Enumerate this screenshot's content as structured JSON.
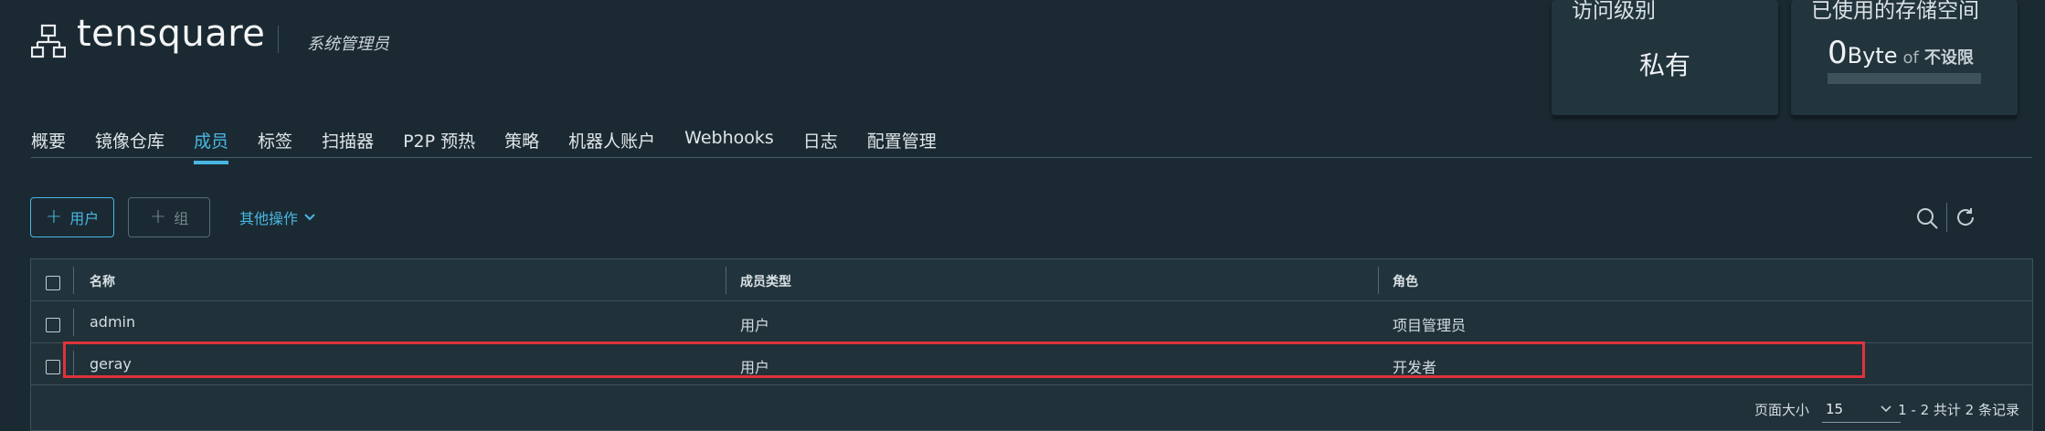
{
  "header": {
    "project_name": "tensquare",
    "role_label": "系统管理员",
    "project_icon": "project-hierarchy-icon"
  },
  "cards": {
    "access": {
      "title": "访问级别",
      "value": "私有"
    },
    "storage": {
      "title": "已使用的存储空间",
      "used_number": "0",
      "used_unit": "Byte",
      "of_label": "of",
      "limit": "不设限",
      "usage_fraction": 0
    }
  },
  "tabs": [
    {
      "label": "概要",
      "active": false
    },
    {
      "label": "镜像仓库",
      "active": false
    },
    {
      "label": "成员",
      "active": true
    },
    {
      "label": "标签",
      "active": false
    },
    {
      "label": "扫描器",
      "active": false
    },
    {
      "label": "P2P 预热",
      "active": false
    },
    {
      "label": "策略",
      "active": false
    },
    {
      "label": "机器人账户",
      "active": false
    },
    {
      "label": "Webhooks",
      "active": false
    },
    {
      "label": "日志",
      "active": false
    },
    {
      "label": "配置管理",
      "active": false
    }
  ],
  "toolbar": {
    "add_user_label": "用户",
    "add_group_label": "组",
    "more_actions_label": "其他操作",
    "search_icon": "search-icon",
    "refresh_icon": "refresh-icon"
  },
  "table": {
    "columns": [
      "名称",
      "成员类型",
      "角色"
    ],
    "rows": [
      {
        "name": "admin",
        "type": "用户",
        "role": "项目管理员"
      },
      {
        "name": "geray",
        "type": "用户",
        "role": "开发者"
      }
    ]
  },
  "pagination": {
    "page_size_label": "页面大小",
    "page_size": "15",
    "summary": "1 - 2 共计 2 条记录"
  },
  "colors": {
    "accent": "#49b7e3",
    "highlight": "#e0323a",
    "background": "#1b2a32"
  }
}
